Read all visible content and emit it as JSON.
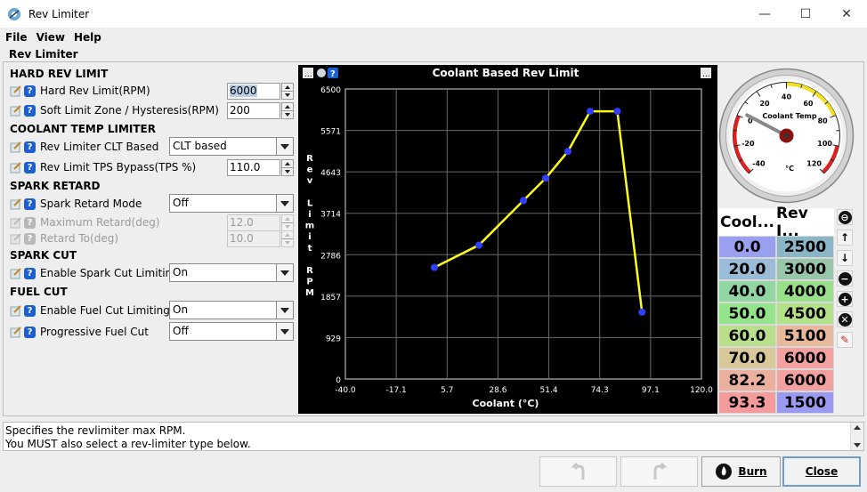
{
  "window": {
    "title": "Rev Limiter",
    "minimize": "—",
    "maximize": "☐",
    "close": "✕"
  },
  "menu": [
    {
      "label": "File"
    },
    {
      "label": "View"
    },
    {
      "label": "Help"
    }
  ],
  "panel_title": "Rev Limiter",
  "sections": {
    "hard": "HARD REV LIMIT",
    "clt": "COOLANT TEMP LIMITER",
    "spark_retard": "SPARK RETARD",
    "spark_cut": "SPARK CUT",
    "fuel_cut": "FUEL CUT"
  },
  "fields": {
    "hard_rev_limit": {
      "label": "Hard Rev Limit(RPM)",
      "value": "6000"
    },
    "soft_limit_zone": {
      "label": "Soft Limit Zone / Hysteresis(RPM)",
      "value": "200"
    },
    "rev_limiter_clt": {
      "label": "Rev Limiter CLT Based",
      "value": "CLT based"
    },
    "tps_bypass": {
      "label": "Rev Limit TPS Bypass(TPS %)",
      "value": "110.0"
    },
    "spark_retard_mode": {
      "label": "Spark Retard Mode",
      "value": "Off"
    },
    "max_retard": {
      "label": "Maximum Retard(deg)",
      "value": "12.0"
    },
    "retard_to": {
      "label": "Retard To(deg)",
      "value": "10.0"
    },
    "spark_cut": {
      "label": "Enable Spark Cut Limiting",
      "value": "On"
    },
    "fuel_cut": {
      "label": "Enable Fuel Cut Limiting",
      "value": "On"
    },
    "prog_fuel_cut": {
      "label": "Progressive Fuel Cut",
      "value": "Off"
    }
  },
  "chart_buttons": {
    "left": "...",
    "right": "...",
    "help": "?"
  },
  "chart_data": {
    "type": "line",
    "title": "Coolant Based Rev Limit",
    "xlabel": "Coolant (°C)",
    "ylabel": "Rev Limit RPM",
    "ylabel_chars": [
      "R",
      "e",
      "v",
      "",
      "L",
      "i",
      "m",
      "i",
      "t",
      "",
      "R",
      "P",
      "M"
    ],
    "x_ticks": [
      "-40.0",
      "-17.1",
      "5.7",
      "28.6",
      "51.4",
      "74.3",
      "97.1",
      "120.0"
    ],
    "y_ticks": [
      "0",
      "929",
      "1857",
      "2786",
      "3714",
      "4643",
      "5571",
      "6500"
    ],
    "xlim": [
      -40,
      120
    ],
    "ylim": [
      0,
      6500
    ],
    "grid": true,
    "colors": {
      "line": "#ffff1a",
      "point": "#2f3fff",
      "background": "#000000",
      "grid": "#6a6a6a"
    },
    "series": [
      {
        "x": [
          0.0,
          20.0,
          40.0,
          50.0,
          60.0,
          70.0,
          82.2,
          93.3
        ],
        "y": [
          2500,
          3000,
          4000,
          4500,
          5100,
          6000,
          6000,
          1500
        ]
      }
    ]
  },
  "gauge": {
    "label": "Coolant Temp",
    "unit": "°C",
    "value": 3,
    "min": -40,
    "max": 120,
    "ticks": [
      "-40",
      "-20",
      "0",
      "20",
      "40",
      "60",
      "80",
      "100",
      "120"
    ]
  },
  "table": {
    "headers": [
      "Cool...",
      "Rev I..."
    ],
    "rows": [
      {
        "clt": "0.0",
        "rpm": "2500",
        "clt_color": "#9aa0f0",
        "rpm_color": "#8ab6c8"
      },
      {
        "clt": "20.0",
        "rpm": "3000",
        "clt_color": "#9bbcd8",
        "rpm_color": "#98c6aa"
      },
      {
        "clt": "40.0",
        "rpm": "4000",
        "clt_color": "#92d6a4",
        "rpm_color": "#98e08a"
      },
      {
        "clt": "50.0",
        "rpm": "4500",
        "clt_color": "#94e48c",
        "rpm_color": "#b4e28a"
      },
      {
        "clt": "60.0",
        "rpm": "5100",
        "clt_color": "#b8e08c",
        "rpm_color": "#e8b89a"
      },
      {
        "clt": "70.0",
        "rpm": "6000",
        "clt_color": "#d8c89a",
        "rpm_color": "#f2a0a0"
      },
      {
        "clt": "82.2",
        "rpm": "6000",
        "clt_color": "#ecb09e",
        "rpm_color": "#f2a0a0"
      },
      {
        "clt": "93.3",
        "rpm": "1500",
        "clt_color": "#f49c9c",
        "rpm_color": "#9a9af2"
      }
    ]
  },
  "table_buttons": [
    "⊖",
    "↑",
    "↓",
    "−",
    "+",
    "✕",
    "✎"
  ],
  "help": {
    "line1": "Specifies the revlimiter max RPM.",
    "line2": "You MUST also select a rev-limiter type below."
  },
  "buttons": {
    "undo": "",
    "redo": "",
    "burn": "Burn",
    "close": "Close"
  }
}
